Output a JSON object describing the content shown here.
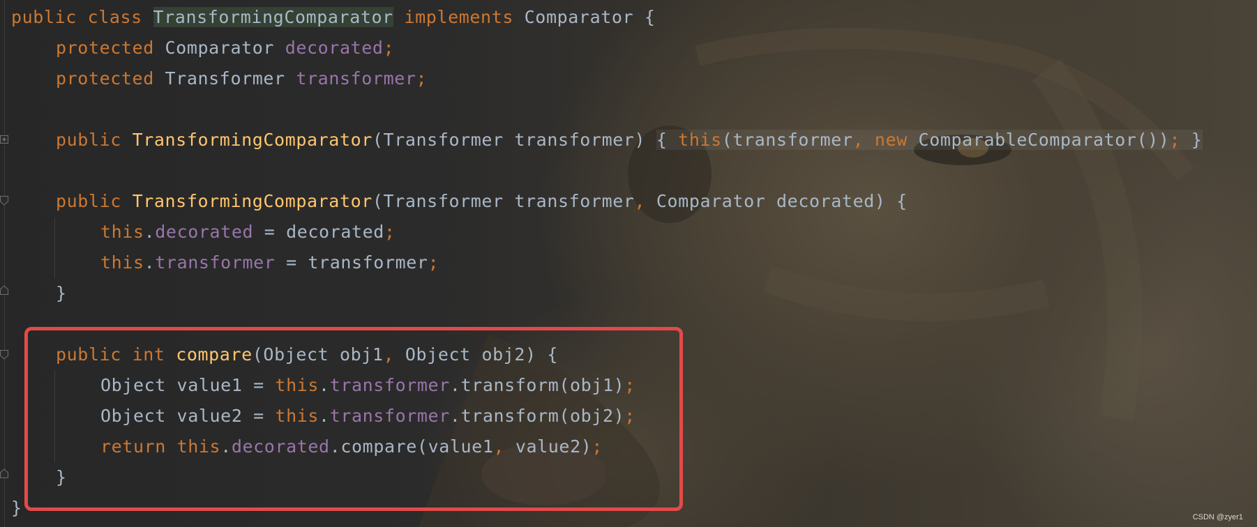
{
  "editor": {
    "lines": {
      "l1": [
        "public",
        "class",
        "TransformingComparator",
        "implements",
        "Comparator",
        "{"
      ],
      "l2": [
        "protected",
        "Comparator",
        "decorated",
        ";"
      ],
      "l3": [
        "protected",
        "Transformer",
        "transformer",
        ";"
      ],
      "l5": [
        "public",
        "TransformingComparator",
        "(Transformer transformer)",
        "{",
        "this",
        "(transformer",
        ",",
        "new",
        "ComparableComparator())",
        ";",
        "}"
      ],
      "l7": [
        "public",
        "TransformingComparator",
        "(Transformer transformer",
        ",",
        "Comparator decorated) {"
      ],
      "l8": [
        "this",
        ".",
        "decorated",
        "= decorated",
        ";"
      ],
      "l9": [
        "this",
        ".",
        "transformer",
        "= transformer",
        ";"
      ],
      "l10": [
        "}"
      ],
      "l12": [
        "public",
        "int",
        "compare",
        "(Object obj1",
        ",",
        "Object obj2) {"
      ],
      "l13": [
        "Object value1 = ",
        "this",
        ".",
        "transformer",
        ".transform(obj1)",
        ";"
      ],
      "l14": [
        "Object value2 = ",
        "this",
        ".",
        "transformer",
        ".transform(obj2)",
        ";"
      ],
      "l15": [
        "return",
        "this",
        ".",
        "decorated",
        ".compare(value1",
        ",",
        "value2)",
        ";"
      ],
      "l16": [
        "}"
      ],
      "l17": [
        "}"
      ]
    }
  },
  "watermark": "CSDN @zyer1",
  "colors": {
    "keyword": "#cc7832",
    "field": "#9876aa",
    "function": "#ffc66d",
    "text": "#a9b7c6",
    "highlight_box": "#e24a4a"
  }
}
